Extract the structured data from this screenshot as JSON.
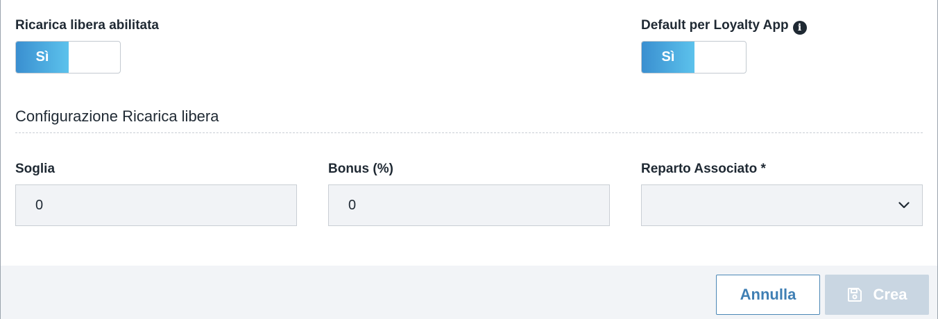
{
  "free_topup": {
    "label": "Ricarica libera abilitata",
    "toggle_on_label": "Sì",
    "enabled": true
  },
  "loyalty_default": {
    "label": "Default per Loyalty App",
    "toggle_on_label": "Sì",
    "enabled": true,
    "icon": "info-icon"
  },
  "section": {
    "title": "Configurazione Ricarica libera"
  },
  "fields": {
    "threshold": {
      "label": "Soglia",
      "value": "0"
    },
    "bonus": {
      "label": "Bonus (%)",
      "value": "0"
    },
    "department": {
      "label": "Reparto Associato *",
      "value": "",
      "icon": "chevron-down-icon"
    }
  },
  "footer": {
    "cancel_label": "Annulla",
    "create_label": "Crea",
    "create_icon": "save-icon"
  },
  "colors": {
    "toggle_gradient_start": "#3a8fd0",
    "toggle_gradient_end": "#5cc2ec",
    "cancel_text": "#3f7fb4",
    "create_disabled_bg": "#c9d6e2"
  }
}
